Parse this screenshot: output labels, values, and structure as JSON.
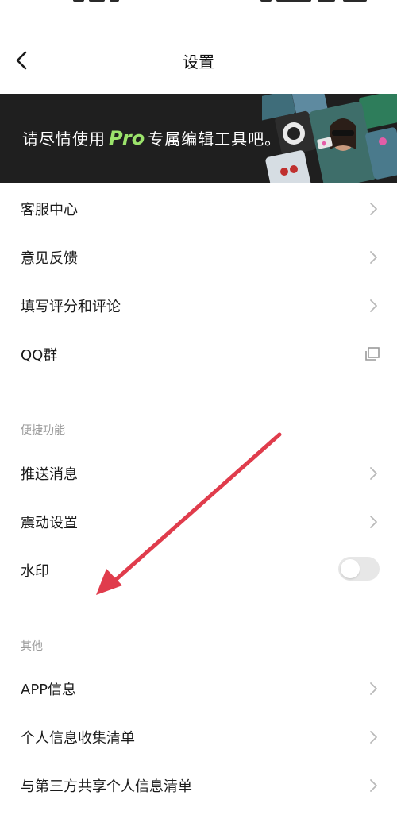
{
  "header": {
    "title": "设置",
    "back_icon": "chevron-left-icon"
  },
  "banner": {
    "text_before": "请尽情使用",
    "pro_word": "Pro",
    "text_after": "专属编辑工具吧。",
    "colors": {
      "background": "#1f1f1f",
      "pro_accent": "#9be36b"
    }
  },
  "rows_top": [
    {
      "label": "客服中心",
      "icon": "chevron-right-icon"
    },
    {
      "label": "意见反馈",
      "icon": "chevron-right-icon"
    },
    {
      "label": "填写评分和评论",
      "icon": "chevron-right-icon"
    },
    {
      "label": "QQ群",
      "icon": "external-window-icon"
    }
  ],
  "section_shortcuts": {
    "header": "便捷功能",
    "rows": [
      {
        "label": "推送消息",
        "icon": "chevron-right-icon"
      },
      {
        "label": "震动设置",
        "icon": "chevron-right-icon"
      },
      {
        "label": "水印",
        "toggle_on": false
      }
    ]
  },
  "section_other": {
    "header": "其他",
    "rows": [
      {
        "label": "APP信息",
        "icon": "chevron-right-icon"
      },
      {
        "label": "个人信息收集清单",
        "icon": "chevron-right-icon"
      },
      {
        "label": "与第三方共享个人信息清单",
        "icon": "chevron-right-icon"
      }
    ]
  },
  "annotation": {
    "type": "arrow",
    "color": "#e03c4c"
  }
}
